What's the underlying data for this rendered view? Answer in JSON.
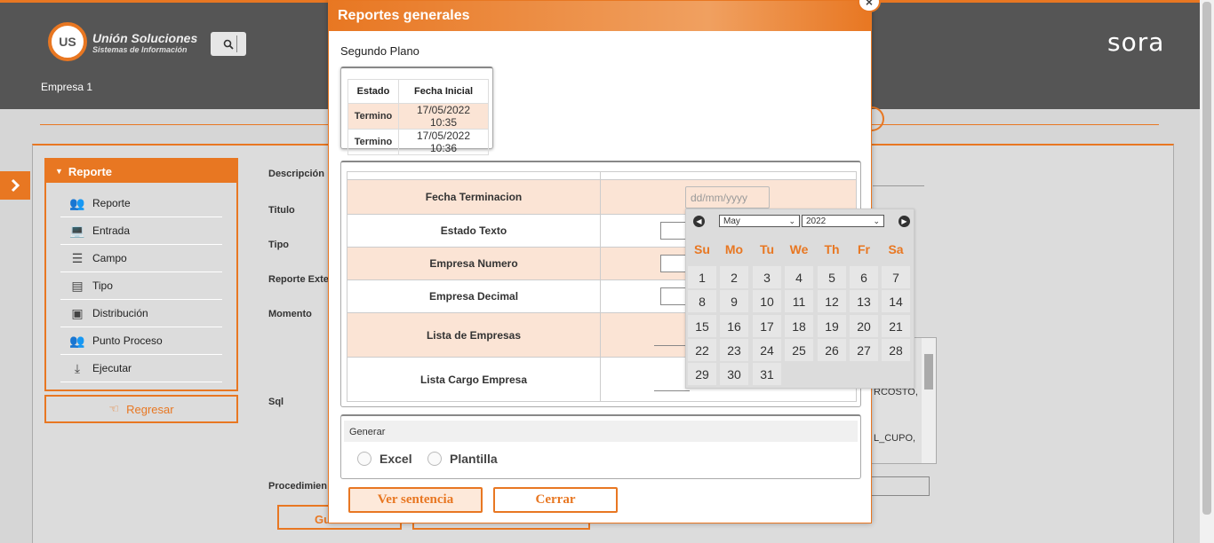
{
  "header": {
    "logo_mark": "US",
    "logo_name": "Unión Soluciones",
    "logo_tagline": "Sistemas de Información",
    "brand": "sora",
    "company": "Empresa 1"
  },
  "sidebar": {
    "title": "Reporte",
    "items": [
      {
        "label": "Reporte",
        "icon": "users-icon"
      },
      {
        "label": "Entrada",
        "icon": "laptop-icon"
      },
      {
        "label": "Campo",
        "icon": "database-icon"
      },
      {
        "label": "Tipo",
        "icon": "list-icon"
      },
      {
        "label": "Distribución",
        "icon": "building-icon"
      },
      {
        "label": "Punto Proceso",
        "icon": "users-icon"
      },
      {
        "label": "Ejecutar",
        "icon": "download-icon"
      }
    ],
    "back_label": "Regresar"
  },
  "form_labels": {
    "descripcion": "Descripción",
    "titulo": "Titulo",
    "tipo": "Tipo",
    "reporte_externo": "Reporte Exte",
    "momento": "Momento",
    "sql": "Sql",
    "procedimiento": "Procedimien",
    "guardar": "Gu",
    "sql_line1": "RCOSTO,",
    "sql_line2": "L_CUPO,"
  },
  "modal": {
    "title": "Reportes generales",
    "subtitle": "Segundo Plano",
    "status_table": {
      "headers": [
        "Estado",
        "Fecha Inicial"
      ],
      "rows": [
        [
          "Termino",
          "17/05/2022 10:35"
        ],
        [
          "Termino",
          "17/05/2022 10:36"
        ]
      ]
    },
    "params": [
      {
        "label": "Fecha Terminacion",
        "placeholder": "dd/mm/yyyy"
      },
      {
        "label": "Estado Texto"
      },
      {
        "label": "Empresa Numero"
      },
      {
        "label": "Empresa Decimal"
      },
      {
        "label": "Lista de Empresas"
      },
      {
        "label": "Lista Cargo Empresa"
      }
    ],
    "generate": {
      "title": "Generar",
      "options": [
        "Excel",
        "Plantilla"
      ]
    },
    "buttons": {
      "view": "Ver sentencia",
      "close": "Cerrar"
    }
  },
  "datepicker": {
    "month": "May",
    "year": "2022",
    "weekdays": [
      "Su",
      "Mo",
      "Tu",
      "We",
      "Th",
      "Fr",
      "Sa"
    ],
    "days": [
      "1",
      "2",
      "3",
      "4",
      "5",
      "6",
      "7",
      "8",
      "9",
      "10",
      "11",
      "12",
      "13",
      "14",
      "15",
      "16",
      "17",
      "18",
      "19",
      "20",
      "21",
      "22",
      "23",
      "24",
      "25",
      "26",
      "27",
      "28",
      "29",
      "30",
      "31"
    ]
  }
}
